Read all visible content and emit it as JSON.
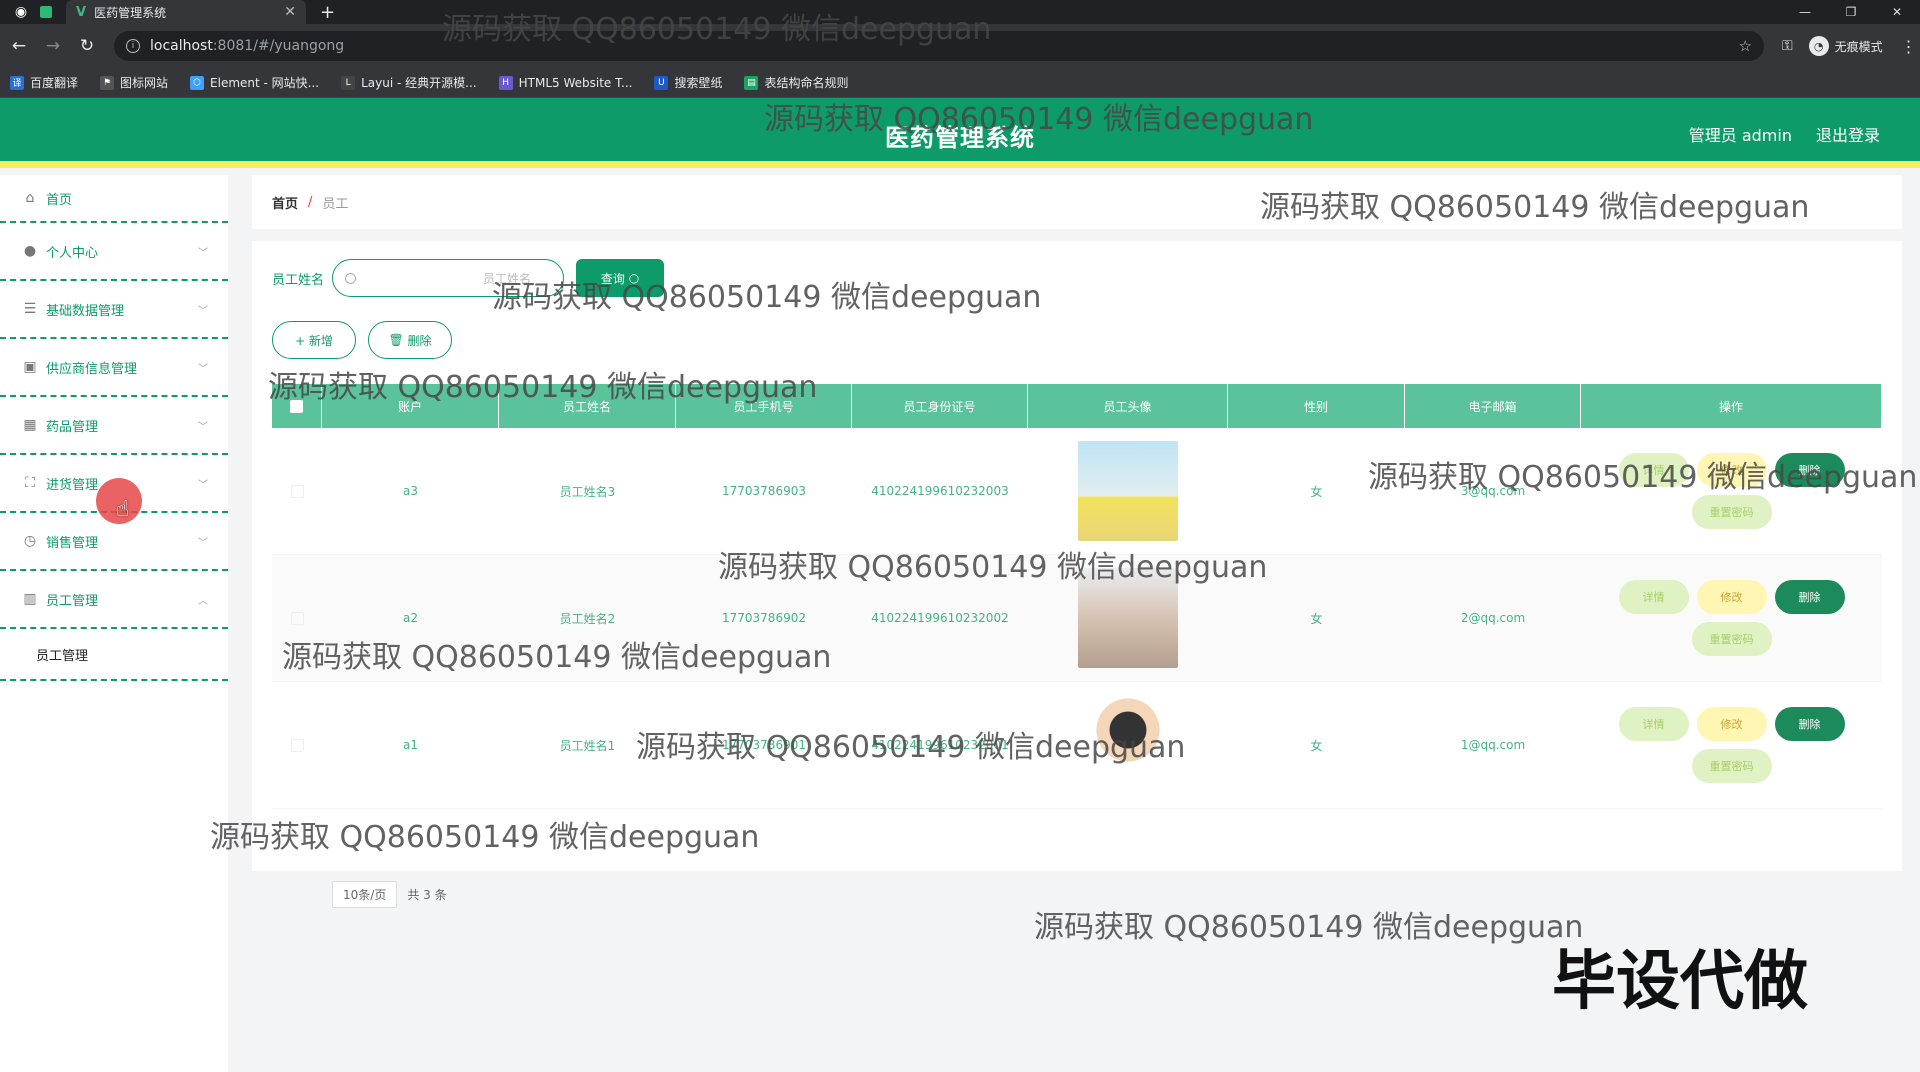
{
  "browser": {
    "tab_title": "医药管理系统",
    "url_host": "localhost",
    "url_rest": ":8081/#/yuangong",
    "incognito_label": "无痕模式",
    "bookmarks": [
      "百度翻译",
      "图标网站",
      "Element - 网站快...",
      "Layui - 经典开源模...",
      "HTML5 Website T...",
      "搜索壁纸",
      "表结构命名规则"
    ]
  },
  "header": {
    "title": "医药管理系统",
    "user": "管理员 admin",
    "logout": "退出登录"
  },
  "sidebar": {
    "items": [
      {
        "label": "首页"
      },
      {
        "label": "个人中心"
      },
      {
        "label": "基础数据管理"
      },
      {
        "label": "供应商信息管理"
      },
      {
        "label": "药品管理"
      },
      {
        "label": "进货管理"
      },
      {
        "label": "销售管理"
      },
      {
        "label": "员工管理"
      }
    ],
    "subitem": "员工管理"
  },
  "breadcrumb": {
    "home": "首页",
    "sep": "/",
    "current": "员工"
  },
  "search": {
    "label": "员工姓名",
    "placeholder": "员工姓名",
    "query_label": "查询"
  },
  "actions": {
    "add_label": "+ 新增",
    "delete_label": "删除"
  },
  "table": {
    "headers": [
      "账户",
      "员工姓名",
      "员工手机号",
      "员工身份证号",
      "员工头像",
      "性别",
      "电子邮箱",
      "操作"
    ],
    "rows": [
      {
        "account": "a3",
        "name": "员工姓名3",
        "phone": "17703786903",
        "id_card": "410224199610232003",
        "sex": "女",
        "email": "3@qq.com"
      },
      {
        "account": "a2",
        "name": "员工姓名2",
        "phone": "17703786902",
        "id_card": "410224199610232002",
        "sex": "女",
        "email": "2@qq.com"
      },
      {
        "account": "a1",
        "name": "员工姓名1",
        "phone": "17703786901",
        "id_card": "410224199610232001",
        "sex": "女",
        "email": "1@qq.com"
      }
    ],
    "ops": {
      "detail": "详情",
      "edit": "修改",
      "delete": "删除",
      "reset": "重置密码"
    }
  },
  "pager": {
    "total": "共 3 条",
    "page_size": "10条/页"
  },
  "watermark": "源码获取 QQ86050149 微信deepguan",
  "overlay_text": "毕设代做",
  "colors": {
    "primary": "#0e9b6a",
    "accent_line": "#f7ef5a",
    "table_head": "#5bc39c"
  }
}
